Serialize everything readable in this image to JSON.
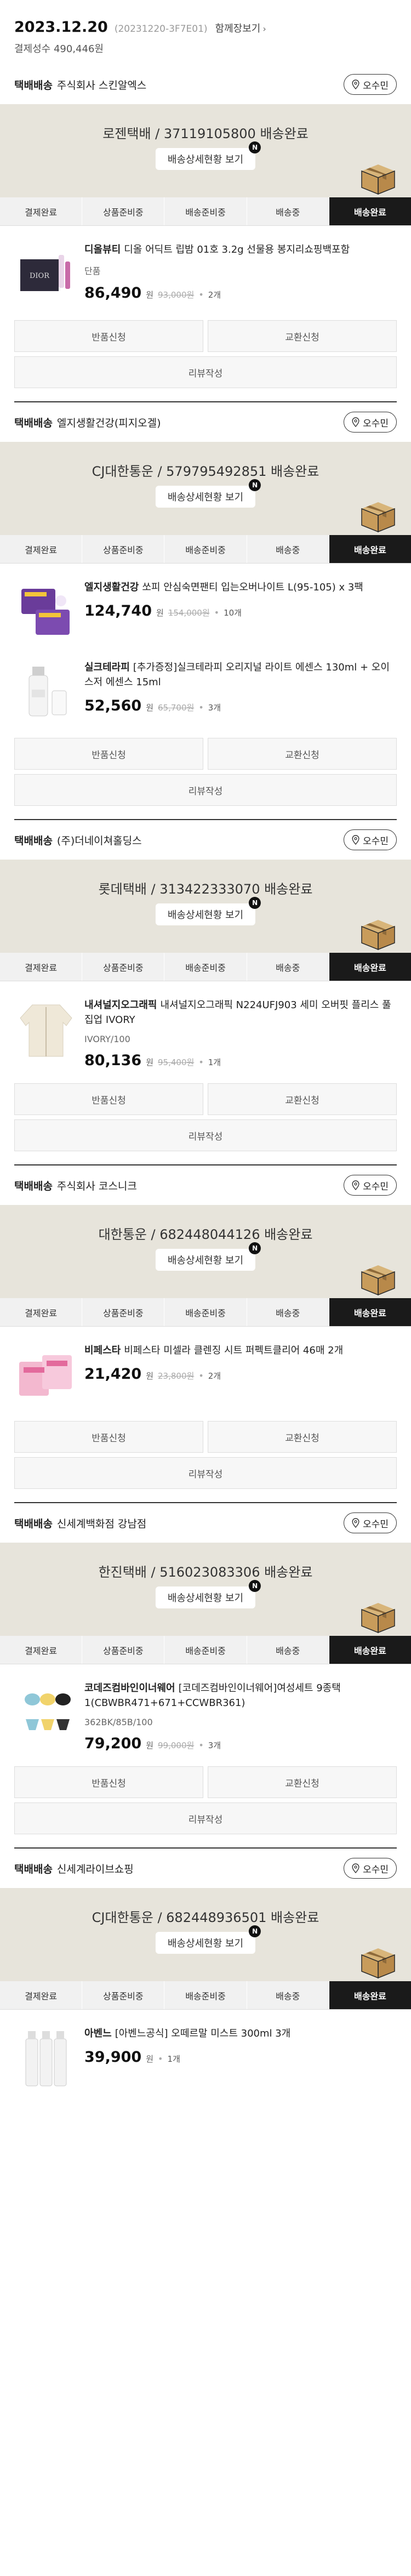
{
  "order": {
    "date": "2023.12.20",
    "order_no": "(20231220-3F7E01)",
    "view_all": "함께장보기",
    "payment": "결제성수 490,446원"
  },
  "labels": {
    "ship_type": "택배배송",
    "pin": "오수민",
    "track": "배송상세현황 보기",
    "new": "N",
    "return": "반품신청",
    "exchange": "교환신청",
    "review": "리뷰작성",
    "won": "원",
    "dot": "•",
    "steps": [
      "결제완료",
      "상품준비중",
      "배송준비중",
      "배송중",
      "배송완료"
    ]
  },
  "icons": {
    "pin": "location-pin-icon",
    "box": "delivery-box-icon",
    "chevron": "chevron-right-icon"
  },
  "colors": {
    "status_bg": "#e7e4db",
    "active_step": "#1a1a1a",
    "box": "#c89c5b"
  },
  "shipments": [
    {
      "seller": "주식회사 스킨알엑스",
      "carrier": "로젠택배 / 37119105800 배송완료",
      "products": [
        {
          "brand": "디올뷰티",
          "name": "디올 어딕트 립밤 01호 3.2g 선물용 봉지리쇼핑백포함",
          "option": "단품",
          "price": "86,490",
          "orig": "93,000원",
          "qty": "2개",
          "thumb": "dior"
        }
      ],
      "actions": true
    },
    {
      "seller": "엘지생활건강(피지오겔)",
      "carrier": "CJ대한통운 / 579795492851 배송완료",
      "products": [
        {
          "brand": "엘지생활건강",
          "name": "쏘피 안심숙면팬티 입는오버나이트 L(95-105) x 3팩",
          "option": "",
          "price": "124,740",
          "orig": "154,000원",
          "qty": "10개",
          "thumb": "pads"
        },
        {
          "brand": "실크테라피",
          "name": "[추가증정]실크테라피 오리지널 라이트 에센스 130ml + 오이스저 에센스 15ml",
          "option": "",
          "price": "52,560",
          "orig": "65,700원",
          "qty": "3개",
          "thumb": "silk"
        }
      ],
      "actions": true
    },
    {
      "seller": "(주)더네이쳐홀딩스",
      "carrier": "롯데택배 / 313422333070 배송완료",
      "products": [
        {
          "brand": "내셔널지오그래픽",
          "name": "내셔널지오그래픽 N224UFJ903 세미 오버핏 플리스 풀집업 IVORY",
          "option": "IVORY/100",
          "price": "80,136",
          "orig": "95,400원",
          "qty": "1개",
          "thumb": "fleece"
        }
      ],
      "actions": true
    },
    {
      "seller": "주식회사 코스니크",
      "carrier": "대한통운 / 682448044126 배송완료",
      "products": [
        {
          "brand": "비페스타",
          "name": "비페스타 미셀라 클렌징 시트 퍼펙트클리어 46매 2개",
          "option": "",
          "price": "21,420",
          "orig": "23,800원",
          "qty": "2개",
          "thumb": "sheet"
        }
      ],
      "actions": true
    },
    {
      "seller": "신세계백화점 강남점",
      "carrier": "한진택배 / 516023083306 배송완료",
      "products": [
        {
          "brand": "코데즈컴바인이너웨어",
          "name": "[코데즈컴바인이너웨어]여성세트 9종택1(CBWBR471+671+CCWBR361)",
          "option": "362BK/85B/100",
          "price": "79,200",
          "orig": "99,000원",
          "qty": "3개",
          "thumb": "lingerie"
        }
      ],
      "actions": true
    },
    {
      "seller": "신세계라이브쇼핑",
      "carrier": "CJ대한통운 / 682448936501 배송완료",
      "products": [
        {
          "brand": "아벤느",
          "name": "[아벤느공식] 오떼르말 미스트 300ml 3개",
          "option": "",
          "price": "39,900",
          "orig": "",
          "qty": "1개",
          "thumb": "mist"
        }
      ],
      "actions": false
    }
  ]
}
